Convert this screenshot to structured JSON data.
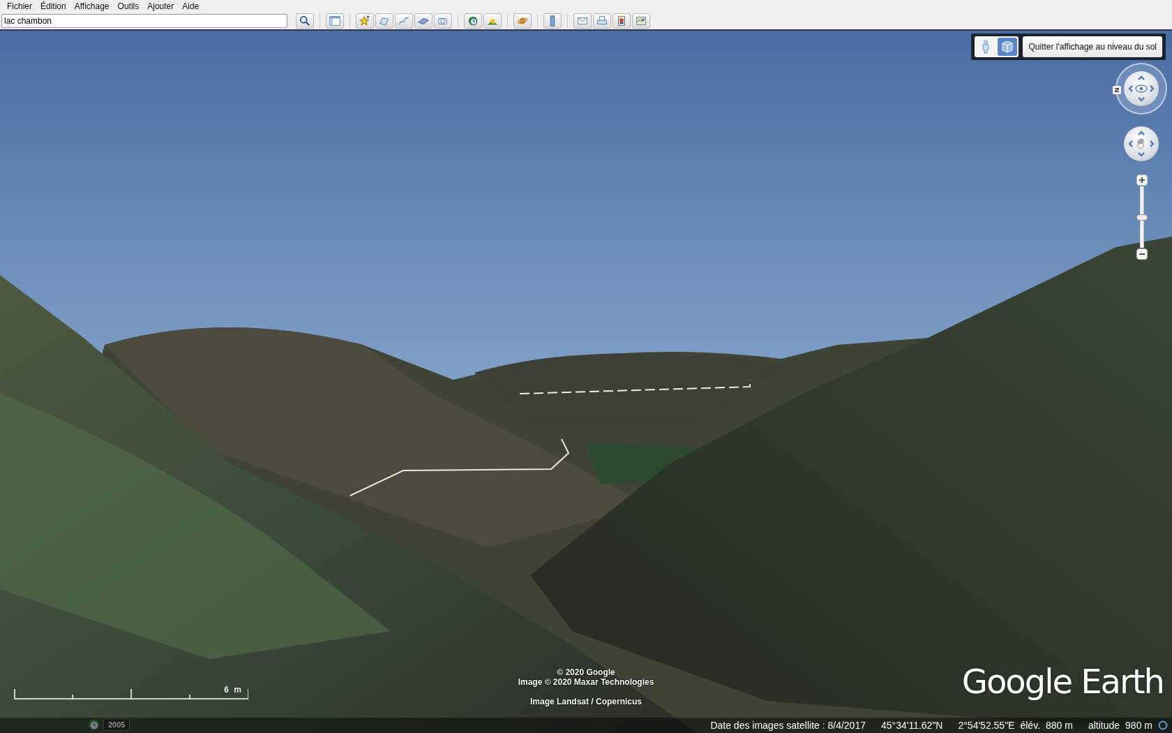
{
  "menu": [
    {
      "label": "Fichier"
    },
    {
      "label": "Édition"
    },
    {
      "label": "Affichage"
    },
    {
      "label": "Outils"
    },
    {
      "label": "Ajouter"
    },
    {
      "label": "Aide"
    }
  ],
  "search": {
    "value": "lac chambon"
  },
  "ground_level": {
    "modes": [
      {
        "kind": "person",
        "selected": false
      },
      {
        "kind": "cube",
        "selected": true
      }
    ],
    "exit_button": "Quitter l'affichage au niveau du sol"
  },
  "navigation": {
    "compass_label": "N",
    "zoom": {
      "level": 0.5
    }
  },
  "scale": {
    "label": "6 m"
  },
  "historical_imagery": {
    "year": "2005"
  },
  "attribution": [
    "© 2020 Google",
    "Image © 2020 Maxar Technologies",
    "Image Landsat / Copernicus"
  ],
  "logo": "Google Earth",
  "status_bar": {
    "imagery_date": "Date des images satellite : 8/4/2017",
    "latitude": "45°34'11.62\"N",
    "longitude": "2°54'52.55\"E",
    "elevation_label": "élév.",
    "elevation": "880 m",
    "altitude_label": "altitude",
    "altitude": "980 m"
  }
}
